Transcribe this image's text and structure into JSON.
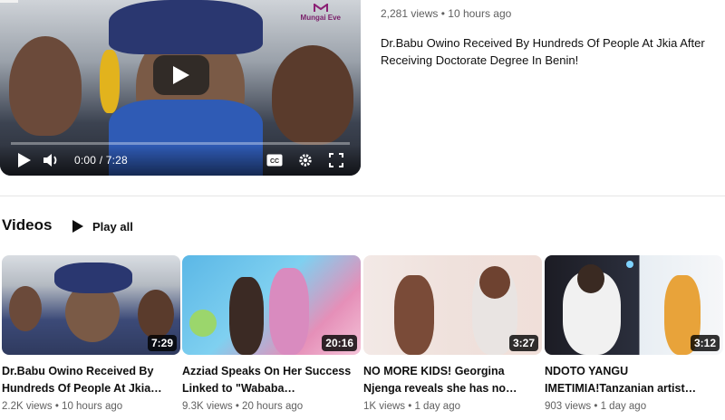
{
  "featured": {
    "watermark": "Mungai Eve",
    "time_display": "0:00 / 7:28",
    "views": "2,281 views",
    "age": "10 hours ago",
    "title": "Dr.Babu Owino  Received By Hundreds Of People At Jkia After Receiving Doctorate Degree In Benin!"
  },
  "shelf": {
    "title": "Videos",
    "play_all": "Play all"
  },
  "videos": [
    {
      "title": "Dr.Babu Owino Received By Hundreds Of People At Jkia…",
      "duration": "7:29",
      "views": "2.2K views",
      "age": "10 hours ago"
    },
    {
      "title": "Azziad Speaks On Her Success Linked to \"Wababa…",
      "duration": "20:16",
      "views": "9.3K views",
      "age": "20 hours ago"
    },
    {
      "title": "NO MORE KIDS! Georgina Njenga reveals she has no…",
      "duration": "3:27",
      "views": "1K views",
      "age": "1 day ago"
    },
    {
      "title": "NDOTO YANGU IMETIMIA!Tanzanian artist…",
      "duration": "3:12",
      "views": "903 views",
      "age": "1 day ago"
    }
  ],
  "meta_separator": "•"
}
